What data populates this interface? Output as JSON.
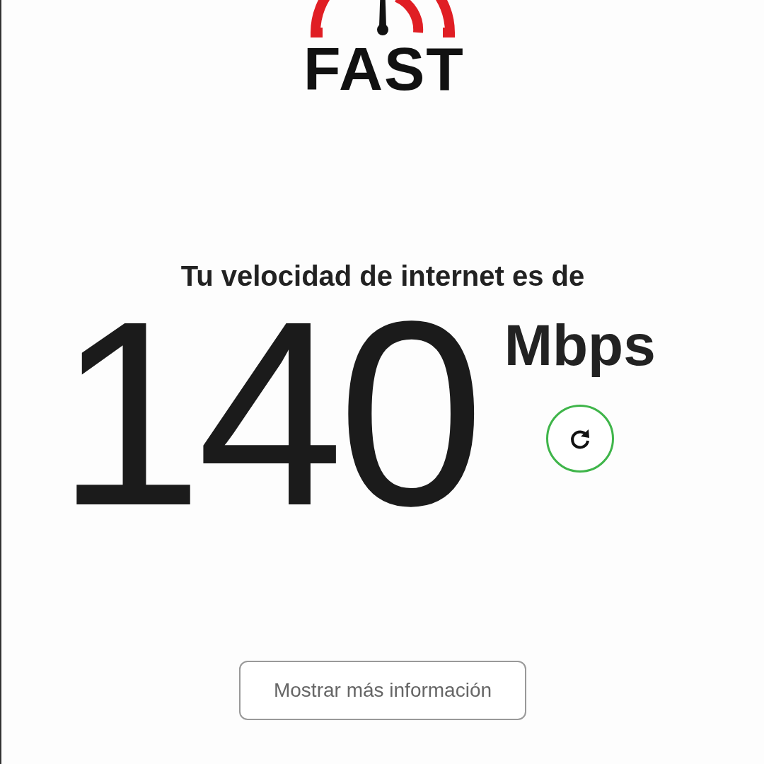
{
  "logo": {
    "text": "FAST"
  },
  "heading": "Tu velocidad de internet es de",
  "speed": {
    "value": "140",
    "unit": "Mbps"
  },
  "more_info_button": "Mostrar más información"
}
